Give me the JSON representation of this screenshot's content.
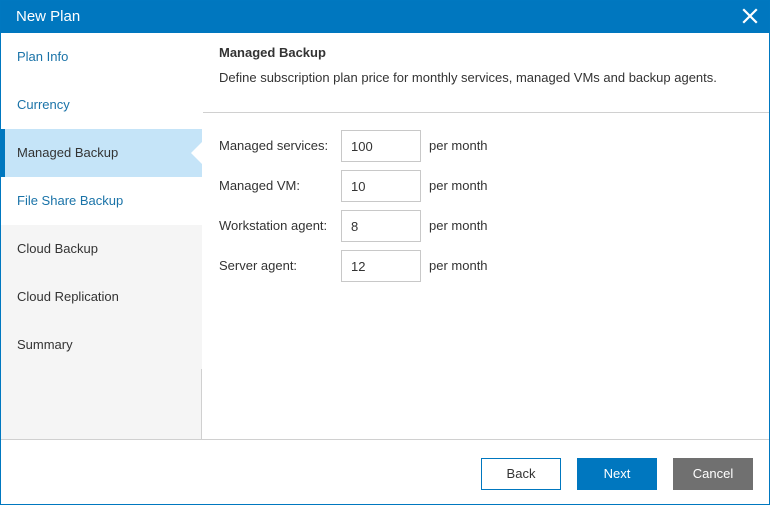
{
  "window": {
    "title": "New Plan",
    "close_icon": "close-icon",
    "accent_color": "#0077bf"
  },
  "sidebar": {
    "items": [
      {
        "label": "Plan Info",
        "state": "link"
      },
      {
        "label": "Currency",
        "state": "link"
      },
      {
        "label": "Managed Backup",
        "state": "active"
      },
      {
        "label": "File Share Backup",
        "state": "link"
      },
      {
        "label": "Cloud Backup",
        "state": "plain"
      },
      {
        "label": "Cloud Replication",
        "state": "plain"
      },
      {
        "label": "Summary",
        "state": "plain"
      }
    ]
  },
  "content": {
    "heading": "Managed Backup",
    "description": "Define subscription plan price for monthly services, managed VMs and backup agents.",
    "fields": [
      {
        "label": "Managed services:",
        "value": "100",
        "unit": "per month"
      },
      {
        "label": "Managed VM:",
        "value": "10",
        "unit": "per month"
      },
      {
        "label": "Workstation agent:",
        "value": "8",
        "unit": "per month"
      },
      {
        "label": "Server agent:",
        "value": "12",
        "unit": "per month"
      }
    ]
  },
  "footer": {
    "back_label": "Back",
    "next_label": "Next",
    "cancel_label": "Cancel"
  }
}
